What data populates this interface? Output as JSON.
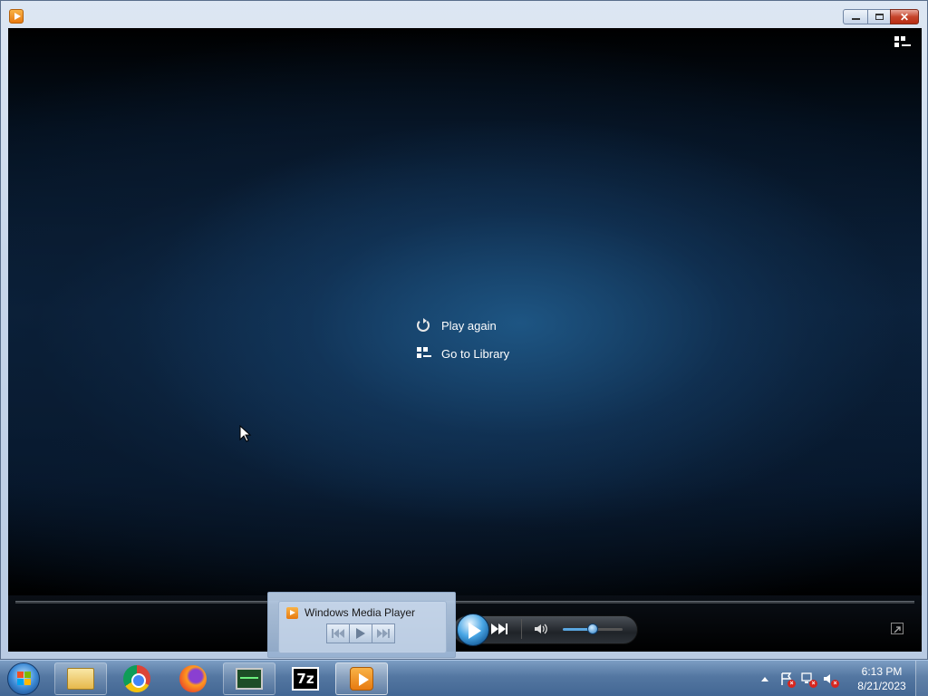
{
  "window": {
    "app_icon": "windows-media-player-icon",
    "caption_buttons": {
      "minimize": "minimize-icon",
      "maximize": "maximize-icon",
      "close": "close-icon"
    }
  },
  "player": {
    "end_menu": [
      {
        "label": "Play again",
        "icon": "replay-icon"
      },
      {
        "label": "Go to Library",
        "icon": "library-icon"
      }
    ],
    "switch_to_library_icon": "switch-to-library-icon",
    "volume_level": 0.5
  },
  "thumbnail": {
    "title": "Windows Media Player"
  },
  "taskbar": {
    "items": [
      {
        "name": "windows-explorer",
        "icon": "folder-icon"
      },
      {
        "name": "google-chrome",
        "icon": "chrome-icon"
      },
      {
        "name": "firefox",
        "icon": "firefox-icon"
      },
      {
        "name": "task-manager",
        "icon": "monitor-icon"
      },
      {
        "name": "7-zip",
        "icon": "7zip-icon",
        "label": "7z"
      },
      {
        "name": "windows-media-player",
        "icon": "wmp-icon"
      }
    ],
    "clock": {
      "time": "6:13 PM",
      "date": "8/21/2023"
    }
  }
}
